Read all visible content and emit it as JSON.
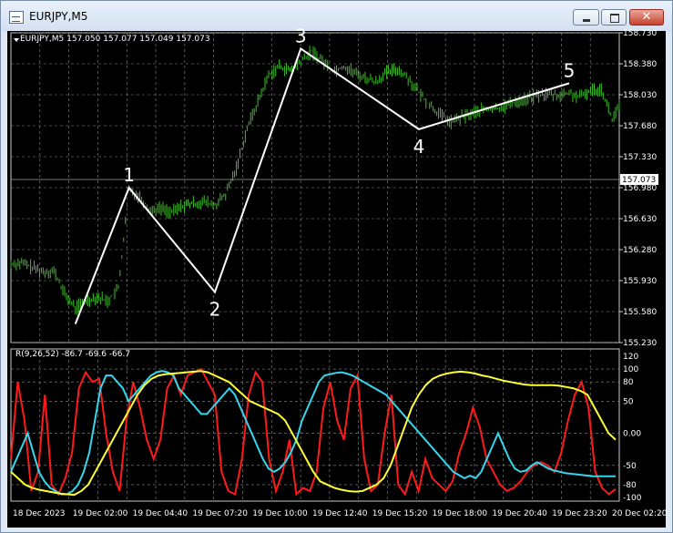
{
  "window": {
    "title": "EURJPY,M5",
    "close_glyph": "✕"
  },
  "ohlc_header": "EURJPY,M5 157.050 157.077 157.049 157.073",
  "indicator_header": "R(9,26,52) -86.7 -69.6 -66.7",
  "colors": {
    "background": "#000000",
    "grid": "#8c8c8c",
    "candles": "#3fbf2a",
    "wave_line": "#ffffff",
    "line_red": "#ff1a1a",
    "line_cyan": "#36d6ef",
    "line_yellow": "#ffff33",
    "current_price_line": "#a0a0a0"
  },
  "chart_data": [
    {
      "type": "line",
      "title": "",
      "price_axis_ticks": [
        "158.730",
        "158.380",
        "158.030",
        "157.680",
        "157.330",
        "156.980",
        "156.630",
        "156.280",
        "155.930",
        "155.580",
        "155.230"
      ],
      "ylim": [
        155.23,
        158.73
      ],
      "current_price": "157.073",
      "x_labels": [
        "18 Dec 2023",
        "19 Dec 02:00",
        "19 Dec 04:40",
        "19 Dec 07:20",
        "19 Dec 10:00",
        "19 Dec 12:40",
        "19 Dec 15:20",
        "19 Dec 18:00",
        "19 Dec 20:40",
        "19 Dec 23:20",
        "20 Dec 02:20"
      ],
      "grid": true,
      "price_path": [
        [
          0,
          156.12
        ],
        [
          3,
          156.13
        ],
        [
          6,
          156.08
        ],
        [
          9,
          156.03
        ],
        [
          12,
          156.04
        ],
        [
          15,
          155.78
        ],
        [
          18,
          155.62
        ],
        [
          21,
          155.7
        ],
        [
          24,
          155.75
        ],
        [
          27,
          155.7
        ],
        [
          30,
          155.84
        ],
        [
          33,
          156.95
        ],
        [
          36,
          156.88
        ],
        [
          39,
          156.72
        ],
        [
          42,
          156.75
        ],
        [
          45,
          156.7
        ],
        [
          48,
          156.78
        ],
        [
          51,
          156.8
        ],
        [
          54,
          156.82
        ],
        [
          57,
          156.78
        ],
        [
          60,
          156.9
        ],
        [
          63,
          157.2
        ],
        [
          66,
          157.65
        ],
        [
          69,
          157.95
        ],
        [
          72,
          158.25
        ],
        [
          75,
          158.35
        ],
        [
          78,
          158.3
        ],
        [
          81,
          158.4
        ],
        [
          84,
          158.52
        ],
        [
          87,
          158.42
        ],
        [
          90,
          158.3
        ],
        [
          93,
          158.35
        ],
        [
          96,
          158.28
        ],
        [
          99,
          158.22
        ],
        [
          102,
          158.18
        ],
        [
          105,
          158.28
        ],
        [
          108,
          158.32
        ],
        [
          111,
          158.22
        ],
        [
          114,
          158.05
        ],
        [
          117,
          157.92
        ],
        [
          120,
          157.8
        ],
        [
          123,
          157.72
        ],
        [
          126,
          157.78
        ],
        [
          129,
          157.82
        ],
        [
          132,
          157.86
        ],
        [
          135,
          157.87
        ],
        [
          138,
          157.9
        ],
        [
          141,
          157.95
        ],
        [
          144,
          157.98
        ],
        [
          147,
          158.02
        ],
        [
          150,
          158.04
        ],
        [
          153,
          158.02
        ],
        [
          156,
          158.05
        ],
        [
          159,
          158.0
        ],
        [
          162,
          158.08
        ],
        [
          165,
          158.1
        ],
        [
          168,
          157.75
        ],
        [
          170,
          157.9
        ]
      ],
      "wave_points": [
        {
          "label": "1",
          "x": 33,
          "y": 156.98
        },
        {
          "label": "2",
          "x": 57,
          "y": 155.8
        },
        {
          "label": "3",
          "x": 81,
          "y": 158.55
        },
        {
          "label": "4",
          "x": 114,
          "y": 157.64
        },
        {
          "label": "5",
          "x": 156,
          "y": 158.16
        }
      ],
      "wave_start": {
        "x": 18,
        "y": 155.44
      }
    },
    {
      "type": "line",
      "title": "",
      "ylim": [
        -100,
        120
      ],
      "indicator_axis_ticks": [
        "120",
        "100",
        "80",
        "50",
        "0.00",
        "-50",
        "-80",
        "-100"
      ],
      "series": [
        {
          "color": "#ff1a1a",
          "values": [
            -40,
            80,
            20,
            -90,
            -60,
            60,
            -80,
            -95,
            -70,
            -30,
            70,
            95,
            80,
            85,
            0,
            -60,
            -90,
            20,
            80,
            40,
            -10,
            -40,
            -10,
            70,
            90,
            60,
            90,
            95,
            100,
            80,
            60,
            -60,
            -90,
            -95,
            -40,
            60,
            95,
            80,
            -40,
            -90,
            -60,
            -10,
            -95,
            -85,
            -90,
            -60,
            40,
            80,
            20,
            -10,
            70,
            90,
            -40,
            -90,
            -80,
            0,
            60,
            -80,
            -95,
            -60,
            -90,
            -40,
            -70,
            -80,
            -90,
            -75,
            -30,
            0,
            40,
            10,
            -40,
            -60,
            -80,
            -90,
            -85,
            -75,
            -60,
            -50,
            -45,
            -50,
            -60,
            -30,
            20,
            60,
            80,
            40,
            -60,
            -85,
            -95,
            -87
          ]
        },
        {
          "color": "#36d6ef",
          "values": [
            -60,
            -40,
            -20,
            0,
            -30,
            -60,
            -75,
            -85,
            -90,
            -95,
            -95,
            -90,
            -80,
            -60,
            -30,
            20,
            70,
            90,
            90,
            80,
            70,
            50,
            60,
            70,
            80,
            90,
            95,
            97,
            95,
            90,
            70,
            60,
            50,
            40,
            30,
            30,
            40,
            50,
            60,
            70,
            60,
            40,
            20,
            0,
            -20,
            -40,
            -55,
            -60,
            -55,
            -45,
            -30,
            -10,
            20,
            40,
            60,
            80,
            90,
            92,
            94,
            95,
            93,
            90,
            85,
            80,
            75,
            70,
            65,
            60,
            50,
            40,
            30,
            20,
            10,
            0,
            -10,
            -20,
            -30,
            -40,
            -50,
            -60,
            -65,
            -70,
            -66,
            -70,
            -60,
            -40,
            -20,
            0,
            -20,
            -40,
            -55,
            -60,
            -58,
            -50,
            -45,
            -50,
            -55,
            -58,
            -60,
            -62,
            -63,
            -64,
            -65,
            -66,
            -67,
            -67,
            -67,
            -67,
            -67
          ]
        },
        {
          "color": "#ffff33",
          "values": [
            -60,
            -70,
            -80,
            -85,
            -88,
            -90,
            -92,
            -94,
            -95,
            -96,
            -90,
            -80,
            -60,
            -40,
            -20,
            0,
            20,
            40,
            60,
            75,
            85,
            90,
            92,
            93,
            94,
            95,
            96,
            97,
            95,
            90,
            85,
            80,
            70,
            60,
            50,
            45,
            40,
            35,
            30,
            20,
            0,
            -20,
            -40,
            -60,
            -75,
            -80,
            -85,
            -88,
            -90,
            -91,
            -90,
            -85,
            -80,
            -70,
            -50,
            -20,
            10,
            40,
            60,
            75,
            85,
            90,
            93,
            95,
            96,
            95,
            93,
            90,
            88,
            85,
            82,
            80,
            78,
            76,
            75,
            75,
            75,
            75,
            74,
            72,
            70,
            66,
            60,
            40,
            20,
            0,
            -10
          ]
        }
      ]
    }
  ],
  "labels_color": "#ffffff"
}
